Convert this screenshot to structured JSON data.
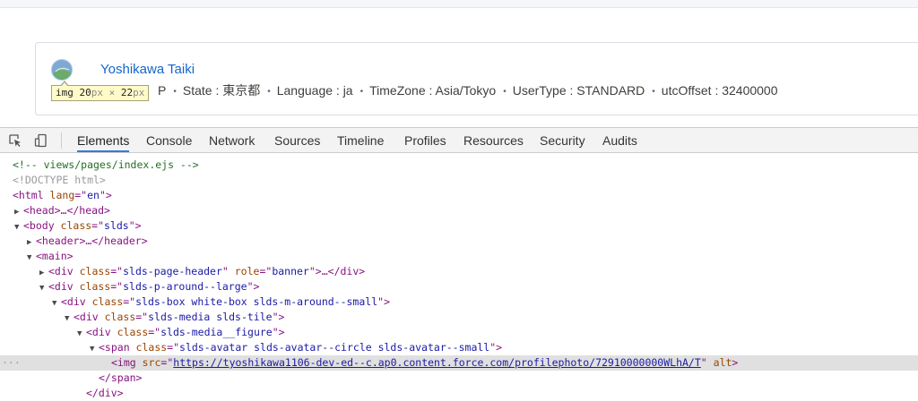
{
  "page": {
    "user_name": "Yoshikawa Taiki",
    "meta_prefix": "P",
    "meta_items": [
      "State : 東京都",
      "Language : ja",
      "TimeZone : Asia/Tokyo",
      "UserType : STANDARD",
      "utcOffset : 32400000"
    ],
    "separator": "•"
  },
  "tooltip": {
    "tag": "img",
    "width": "20",
    "px1": "px",
    "times": "×",
    "height": "22",
    "px2": "px"
  },
  "devtools": {
    "tabs": [
      "Elements",
      "Console",
      "Network",
      "Sources",
      "Timeline",
      "Profiles",
      "Resources",
      "Security",
      "Audits"
    ],
    "active_tab": "Elements",
    "icons": {
      "inspect": "inspect-element-icon",
      "device": "device-mode-icon"
    }
  },
  "code": {
    "l1": "<!-- views/pages/index.ejs -->",
    "l2": "<!DOCTYPE html>",
    "l3_tag_open": "<html ",
    "l3_attr": "lang",
    "l3_eq": "=\"",
    "l3_val": "en",
    "l3_close": "\">",
    "l4": "<head>…</head>",
    "l5_tag_open": "<body ",
    "l5_attr": "class",
    "l5_val": "slds",
    "l5_close": "\">",
    "l6": "<header>…</header>",
    "l7": "<main>",
    "l8_tag_open": "<div ",
    "l8_attr1": "class",
    "l8_val1": "slds-page-header",
    "l8_attr2": "role",
    "l8_val2": "banner",
    "l8_close": ">…</div>",
    "l9_tag_open": "<div ",
    "l9_attr": "class",
    "l9_val": "slds-p-around--large",
    "l9_close": "\">",
    "l10_tag_open": "<div ",
    "l10_attr": "class",
    "l10_val": "slds-box white-box slds-m-around--small",
    "l10_close": "\">",
    "l11_tag_open": "<div ",
    "l11_attr": "class",
    "l11_val": "slds-media slds-tile",
    "l11_close": "\">",
    "l12_tag_open": "<div ",
    "l12_attr": "class",
    "l12_val": "slds-media__figure",
    "l12_close": "\">",
    "l13_tag_open": "<span ",
    "l13_attr": "class",
    "l13_val": "slds-avatar slds-avatar--circle slds-avatar--small",
    "l13_close": "\">",
    "l14_tag_open": "<img ",
    "l14_attr1": "src",
    "l14_val1": "https://tyoshikawa1106-dev-ed--c.ap0.content.force.com/profilephoto/72910000000WLhA/T",
    "l14_attr2": "alt",
    "l14_close": ">",
    "l15": "</span>",
    "l16": "</div>",
    "dots": "..."
  },
  "colors": {
    "link": "#1466c7",
    "tab_active_underline": "#3879d9",
    "tooltip_bg": "#fffbc8"
  }
}
